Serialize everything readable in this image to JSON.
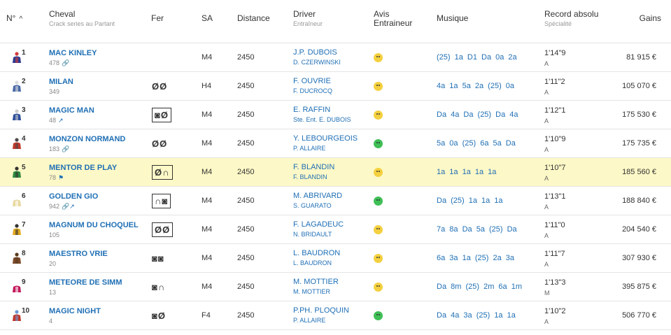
{
  "header": {
    "num": "N°",
    "cheval": "Cheval",
    "cheval_sub": "Crack series au Partant",
    "fer": "Fer",
    "sa": "SA",
    "distance": "Distance",
    "driver": "Driver",
    "driver_sub": "Entraîneur",
    "avis_line1": "Avis",
    "avis_line2": "Entraineur",
    "musique": "Musique",
    "record": "Record absolu",
    "record_sub": "Spécialité",
    "gains": "Gains"
  },
  "colors": {
    "link": "#1f6fb5",
    "highlight_row": "#fdf8c7",
    "avis_yellow": "#f4d03f",
    "avis_green": "#3fbf56"
  },
  "rows": [
    {
      "num": "1",
      "name": "MAC KINLEY",
      "sub": "478",
      "extra": "🔗",
      "fer": "",
      "fer_boxed": false,
      "sa": "M4",
      "distance": "2450",
      "driver": "J.P. DUBOIS",
      "trainer": "D. CZERWINSKI",
      "avis": "yellow",
      "music": "(25) 1a  D1  Da  0a  2a",
      "record": "1'14\"9",
      "record_sub": "A",
      "gains": "81 915 €",
      "silk": [
        "#2b3a8f",
        "#d23b3b"
      ]
    },
    {
      "num": "2",
      "name": "MILAN",
      "sub": "349",
      "extra": "",
      "fer": "ØØ",
      "fer_boxed": false,
      "sa": "H4",
      "distance": "2450",
      "driver": "F. OUVRIE",
      "trainer": "F. DUCROCQ",
      "avis": "yellow",
      "music": "4a  1a  5a  2a  (25) 0a",
      "record": "1'11\"2",
      "record_sub": "A",
      "gains": "105 070 €",
      "silk": [
        "#4b6aa8",
        "#dddddd"
      ]
    },
    {
      "num": "3",
      "name": "MAGIC MAN",
      "sub": "48",
      "extra": "↗",
      "fer": "◙Ø",
      "fer_boxed": true,
      "sa": "M4",
      "distance": "2450",
      "driver": "E. RAFFIN",
      "trainer": "Ste. Ent. E. DUBOIS",
      "avis": "yellow",
      "music": "Da  4a  Da  (25) Da  4a",
      "record": "1'12\"1",
      "record_sub": "A",
      "gains": "175 530 €",
      "silk": [
        "#2d4e9c",
        "#cccccc"
      ]
    },
    {
      "num": "4",
      "name": "MONZON NORMAND",
      "sub": "183",
      "extra": "🔗",
      "fer": "ØØ",
      "fer_boxed": false,
      "sa": "M4",
      "distance": "2450",
      "driver": "Y. LEBOURGEOIS",
      "trainer": "P. ALLAIRE",
      "avis": "green",
      "music": "5a  0a  (25) 6a  5a  Da",
      "record": "1'10\"9",
      "record_sub": "A",
      "gains": "175 735 €",
      "silk": [
        "#c0392b",
        "#4a4a4a"
      ]
    },
    {
      "num": "5",
      "name": "MENTOR DE PLAY",
      "sub": "78",
      "extra": "⚑",
      "fer": "Ø∩",
      "fer_boxed": true,
      "sa": "M4",
      "distance": "2450",
      "driver": "F. BLANDIN",
      "trainer": "F. BLANDIN",
      "avis": "yellow",
      "music": "1a  1a  1a  1a  1a",
      "record": "1'10\"7",
      "record_sub": "A",
      "gains": "185 560 €",
      "silk": [
        "#2e8b3e",
        "#333333"
      ],
      "highlight": true
    },
    {
      "num": "6",
      "name": "GOLDEN GIO",
      "sub": "942",
      "extra": "🔗↗",
      "fer": "∩◙",
      "fer_boxed": true,
      "sa": "M4",
      "distance": "2450",
      "driver": "M. ABRIVARD",
      "trainer": "S. GUARATO",
      "avis": "green",
      "music": "Da  (25) 1a  1a  1a",
      "record": "1'13\"1",
      "record_sub": "A",
      "gains": "188 840 €",
      "silk": [
        "#e8d9a0",
        "#ffffff"
      ]
    },
    {
      "num": "7",
      "name": "MAGNUM DU CHOQUEL",
      "sub": "105",
      "extra": "",
      "fer": "ØØ",
      "fer_boxed": true,
      "sa": "M4",
      "distance": "2450",
      "driver": "F. LAGADEUC",
      "trainer": "N. BRIDAULT",
      "avis": "yellow",
      "music": "7a  8a  Da  5a  (25) Da",
      "record": "1'11\"0",
      "record_sub": "A",
      "gains": "204 540 €",
      "silk": [
        "#e0a91f",
        "#333333"
      ]
    },
    {
      "num": "8",
      "name": "MAESTRO VRIE",
      "sub": "20",
      "extra": "",
      "fer": "◙◙",
      "fer_boxed": false,
      "sa": "M4",
      "distance": "2450",
      "driver": "L. BAUDRON",
      "trainer": "L. BAUDRON",
      "avis": "yellow",
      "music": "6a  3a  1a  (25) 2a  3a",
      "record": "1'11\"7",
      "record_sub": "A",
      "gains": "307 930 €",
      "silk": [
        "#7a4a2a",
        "#5a3a1a"
      ]
    },
    {
      "num": "9",
      "name": "METEORE DE SIMM",
      "sub": "13",
      "extra": "",
      "fer": "◙∩",
      "fer_boxed": false,
      "sa": "M4",
      "distance": "2450",
      "driver": "M. MOTTIER",
      "trainer": "M. MOTTIER",
      "avis": "yellow",
      "music": "Da  8m  (25) 2m  6a  1m",
      "record": "1'13\"3",
      "record_sub": "M",
      "gains": "395 875 €",
      "silk": [
        "#c2185b",
        "#ffffff"
      ]
    },
    {
      "num": "10",
      "name": "MAGIC NIGHT",
      "sub": "4",
      "extra": "",
      "fer": "◙Ø",
      "fer_boxed": false,
      "sa": "F4",
      "distance": "2450",
      "driver": "P.PH. PLOQUIN",
      "trainer": "P. ALLAIRE",
      "avis": "green",
      "music": "Da  4a  3a  (25) 1a  1a",
      "record": "1'10\"2",
      "record_sub": "A",
      "gains": "506 770 €",
      "silk": [
        "#c0392b",
        "#6a9bd8"
      ]
    }
  ]
}
